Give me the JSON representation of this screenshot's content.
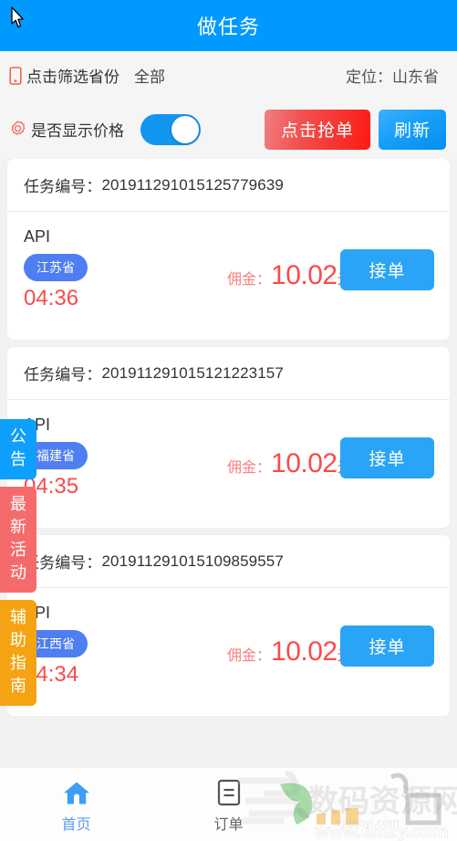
{
  "header": {
    "title": "做任务",
    "bg_color": "#0099ff"
  },
  "filter_bar": {
    "icon": "phone-filter-icon",
    "label": "点击筛选省份",
    "value": "全部",
    "location_text": "定位：山东省"
  },
  "price_bar": {
    "icon": "gear-icon",
    "label": "是否显示价格",
    "toggle_on": true,
    "grab_button": "点击抢单",
    "refresh_button": "刷新",
    "grab_color": "#fc1a12",
    "refresh_color": "#0a93f2"
  },
  "tasks": [
    {
      "no_label": "任务编号：",
      "no_value": "201911291015125779639",
      "type": "API",
      "province": "江苏省",
      "timer": "04:36",
      "commission_label": "佣金：",
      "commission_value": "10.02",
      "commission_unit": "元",
      "accept_button": "接单"
    },
    {
      "no_label": "任务编号：",
      "no_value": "201911291015121223157",
      "type": "API",
      "province": "福建省",
      "timer": "04:35",
      "commission_label": "佣金：",
      "commission_value": "10.02",
      "commission_unit": "元",
      "accept_button": "接单"
    },
    {
      "no_label": "任务编号：",
      "no_value": "201911291015109859557",
      "type": "API",
      "province": "江西省",
      "timer": "04:34",
      "commission_label": "佣金：",
      "commission_value": "10.02",
      "commission_unit": "元",
      "accept_button": "接单"
    }
  ],
  "side_tabs": [
    {
      "name": "notice",
      "chars": [
        "公",
        "告"
      ],
      "color": "#0d9ffb"
    },
    {
      "name": "activity",
      "chars": [
        "最",
        "新",
        "活",
        "动"
      ],
      "color": "#f56b6b"
    },
    {
      "name": "guide",
      "chars": [
        "辅",
        "助",
        "指",
        "南"
      ],
      "color": "#f5a312"
    }
  ],
  "bottom_nav": [
    {
      "icon": "home-icon",
      "label": "首页",
      "active": true
    },
    {
      "icon": "order-icon",
      "label": "订单",
      "active": false
    }
  ],
  "watermark": {
    "site_name": "数码资源网",
    "url": "www.smzy.com"
  }
}
